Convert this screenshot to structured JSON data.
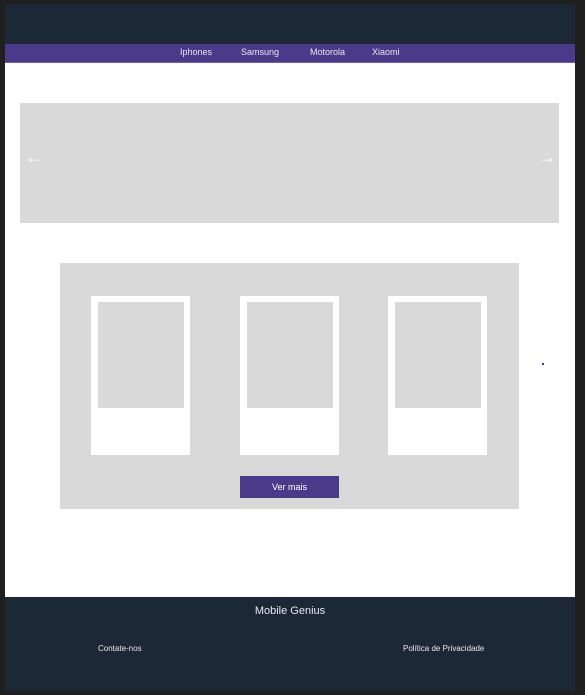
{
  "nav": {
    "items": [
      "Iphones",
      "Samsung",
      "Motorola",
      "Xiaomi"
    ]
  },
  "carousel": {
    "prev_icon": "arrow-left-icon",
    "next_icon": "arrow-right-icon",
    "prev": "←",
    "next": "→"
  },
  "products": {
    "button_label": "Ver mais"
  },
  "footer": {
    "brand": "Mobile Genius",
    "contact": "Contate-nos",
    "privacy": "Política de Privacidade"
  },
  "colors": {
    "header": "#1d2836",
    "nav": "#4a3b8a",
    "placeholder": "#d9d9d9"
  }
}
